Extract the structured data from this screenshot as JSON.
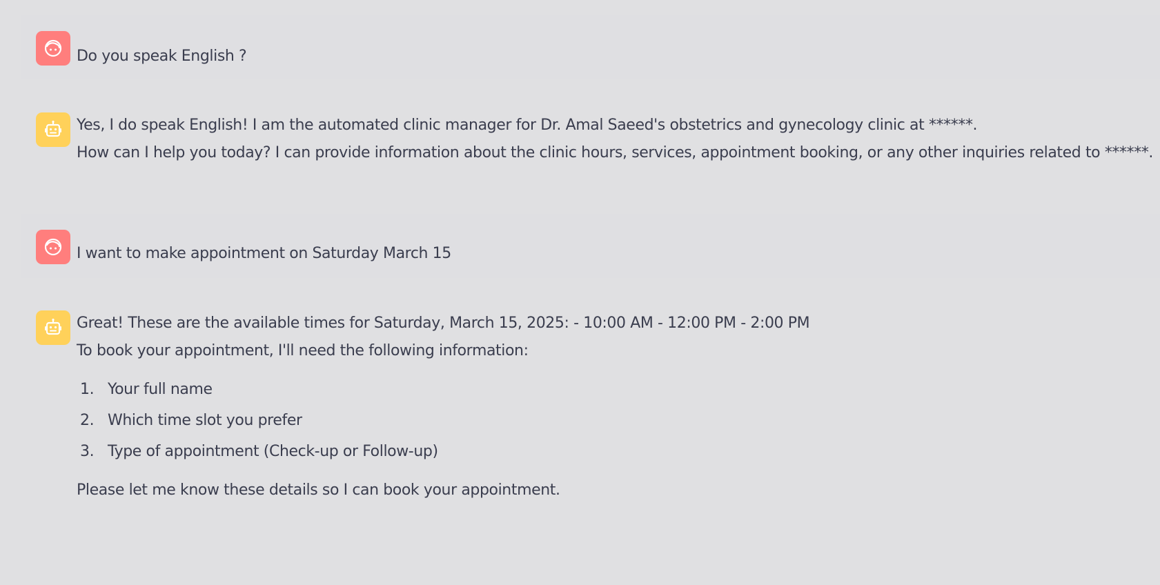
{
  "messages": [
    {
      "role": "user",
      "avatar_icon": "user-face-icon",
      "lines": [
        "Do you speak English ?"
      ]
    },
    {
      "role": "assistant",
      "avatar_icon": "robot-icon",
      "lines": [
        "Yes, I do speak English! I am the automated clinic manager for Dr. Amal Saeed's obstetrics and gynecology clinic at ******.",
        "How can I help you today? I can provide information about the clinic hours, services, appointment booking, or any other inquiries related to ******."
      ]
    },
    {
      "role": "user",
      "avatar_icon": "user-face-icon",
      "lines": [
        "I want to make appointment on Saturday March 15"
      ]
    },
    {
      "role": "assistant",
      "avatar_icon": "robot-icon",
      "lines": [
        "Great! These are the available times for Saturday, March 15, 2025: - 10:00 AM - 12:00 PM - 2:00 PM",
        "To book your appointment, I'll need the following information:"
      ],
      "list": [
        {
          "num": "1.",
          "text": "Your full name"
        },
        {
          "num": "2.",
          "text": "Which time slot you prefer"
        },
        {
          "num": "3.",
          "text": "Type of appointment (Check-up or Follow-up)"
        }
      ],
      "closing": "Please let me know these details so I can book your appointment."
    }
  ],
  "colors": {
    "background": "#e0e0e2",
    "user_avatar": "#ff7e7d",
    "assistant_avatar": "#ffd15a",
    "text": "#3a3d4e"
  }
}
